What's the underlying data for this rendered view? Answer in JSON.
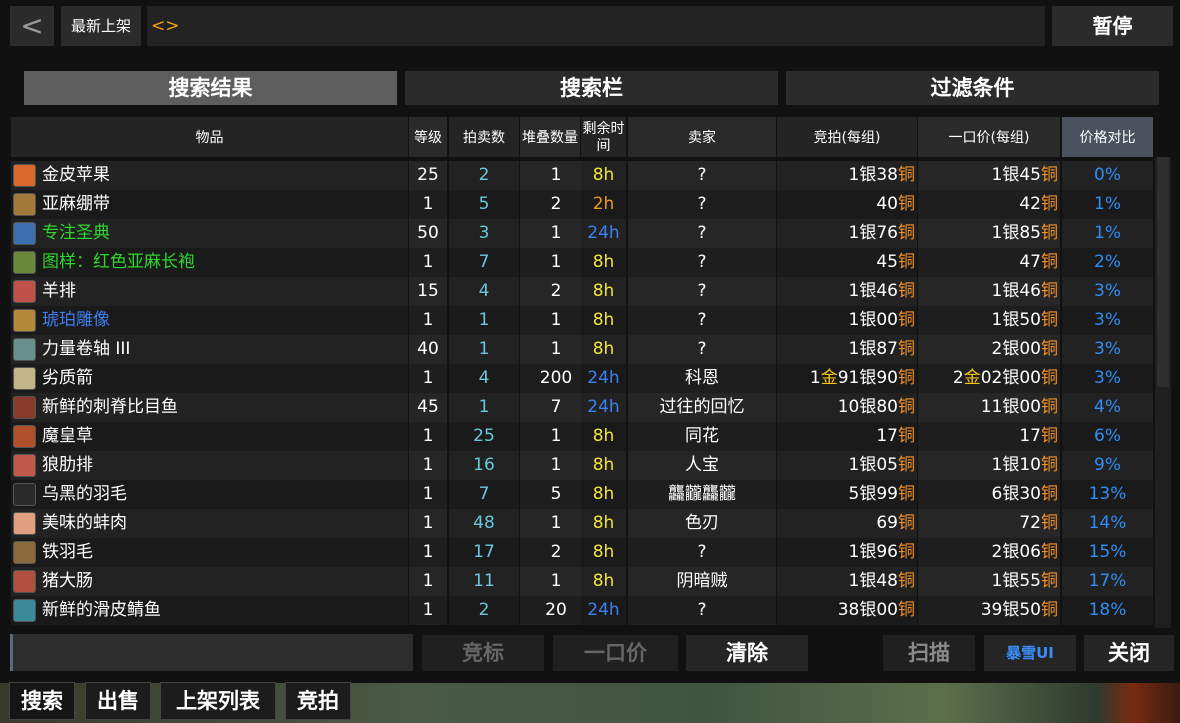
{
  "topbar": {
    "back_label": "<",
    "tag_label": "最新上架",
    "search_value": "<>",
    "pause_label": "暂停"
  },
  "tabs": [
    "搜索结果",
    "搜索栏",
    "过滤条件"
  ],
  "columns": {
    "item": "物品",
    "level": "等级",
    "auctions": "拍卖数",
    "stack": "堆叠数量",
    "time": "剩余时间",
    "seller": "卖家",
    "bid": "竞拍(每组)",
    "buyout": "一口价(每组)",
    "compare": "价格对比"
  },
  "rows": [
    {
      "name": "金皮苹果",
      "quality": "white",
      "icon": "apple-icon",
      "level": "25",
      "auctions": "2",
      "stack": "1",
      "time": "8h",
      "seller": "?",
      "bid": [
        [
          "1",
          "银"
        ],
        [
          "38",
          "铜"
        ]
      ],
      "buyout": [
        [
          "1",
          "银"
        ],
        [
          "45",
          "铜"
        ]
      ],
      "pct": "0%"
    },
    {
      "name": "亚麻绷带",
      "quality": "white",
      "icon": "bandage-icon",
      "level": "1",
      "auctions": "5",
      "stack": "2",
      "time": "2h",
      "seller": "?",
      "bid": [
        [
          "40",
          "铜"
        ]
      ],
      "buyout": [
        [
          "42",
          "铜"
        ]
      ],
      "pct": "1%"
    },
    {
      "name": "专注圣典",
      "quality": "green",
      "icon": "book-icon",
      "level": "50",
      "auctions": "3",
      "stack": "1",
      "time": "24h",
      "seller": "?",
      "bid": [
        [
          "1",
          "银"
        ],
        [
          "76",
          "铜"
        ]
      ],
      "buyout": [
        [
          "1",
          "银"
        ],
        [
          "85",
          "铜"
        ]
      ],
      "pct": "1%"
    },
    {
      "name": "图样：红色亚麻长袍",
      "quality": "green",
      "icon": "pattern-icon",
      "level": "1",
      "auctions": "7",
      "stack": "1",
      "time": "8h",
      "seller": "?",
      "bid": [
        [
          "45",
          "铜"
        ]
      ],
      "buyout": [
        [
          "47",
          "铜"
        ]
      ],
      "pct": "2%"
    },
    {
      "name": "羊排",
      "quality": "white",
      "icon": "meat-icon",
      "level": "15",
      "auctions": "4",
      "stack": "2",
      "time": "8h",
      "seller": "?",
      "bid": [
        [
          "1",
          "银"
        ],
        [
          "46",
          "铜"
        ]
      ],
      "buyout": [
        [
          "1",
          "银"
        ],
        [
          "46",
          "铜"
        ]
      ],
      "pct": "3%"
    },
    {
      "name": "琥珀雕像",
      "quality": "blue",
      "icon": "statue-icon",
      "level": "1",
      "auctions": "1",
      "stack": "1",
      "time": "8h",
      "seller": "?",
      "bid": [
        [
          "1",
          "银"
        ],
        [
          "00",
          "铜"
        ]
      ],
      "buyout": [
        [
          "1",
          "银"
        ],
        [
          "50",
          "铜"
        ]
      ],
      "pct": "3%"
    },
    {
      "name": "力量卷轴 III",
      "quality": "white",
      "icon": "scroll-icon",
      "level": "40",
      "auctions": "1",
      "stack": "1",
      "time": "8h",
      "seller": "?",
      "bid": [
        [
          "1",
          "银"
        ],
        [
          "87",
          "铜"
        ]
      ],
      "buyout": [
        [
          "2",
          "银"
        ],
        [
          "00",
          "铜"
        ]
      ],
      "pct": "3%"
    },
    {
      "name": "劣质箭",
      "quality": "white",
      "icon": "arrow-icon",
      "level": "1",
      "auctions": "4",
      "stack": "200",
      "time": "24h",
      "seller": "科恩",
      "bid": [
        [
          "1",
          "金"
        ],
        [
          "91",
          "银"
        ],
        [
          "90",
          "铜"
        ]
      ],
      "buyout": [
        [
          "2",
          "金"
        ],
        [
          "02",
          "银"
        ],
        [
          "00",
          "铜"
        ]
      ],
      "pct": "3%"
    },
    {
      "name": "新鲜的刺脊比目鱼",
      "quality": "white",
      "icon": "fish-icon",
      "level": "45",
      "auctions": "1",
      "stack": "7",
      "time": "24h",
      "seller": "过往的回忆",
      "bid": [
        [
          "10",
          "银"
        ],
        [
          "80",
          "铜"
        ]
      ],
      "buyout": [
        [
          "11",
          "银"
        ],
        [
          "00",
          "铜"
        ]
      ],
      "pct": "4%"
    },
    {
      "name": "魔皇草",
      "quality": "white",
      "icon": "herb-icon",
      "level": "1",
      "auctions": "25",
      "stack": "1",
      "time": "8h",
      "seller": "同花",
      "bid": [
        [
          "17",
          "铜"
        ]
      ],
      "buyout": [
        [
          "17",
          "铜"
        ]
      ],
      "pct": "6%"
    },
    {
      "name": "狼肋排",
      "quality": "white",
      "icon": "ribs-icon",
      "level": "1",
      "auctions": "16",
      "stack": "1",
      "time": "8h",
      "seller": "人宝",
      "bid": [
        [
          "1",
          "银"
        ],
        [
          "05",
          "铜"
        ]
      ],
      "buyout": [
        [
          "1",
          "银"
        ],
        [
          "10",
          "铜"
        ]
      ],
      "pct": "9%"
    },
    {
      "name": "乌黑的羽毛",
      "quality": "white",
      "icon": "feather-icon",
      "level": "1",
      "auctions": "7",
      "stack": "5",
      "time": "8h",
      "seller": "龘龖龘龖",
      "bid": [
        [
          "5",
          "银"
        ],
        [
          "99",
          "铜"
        ]
      ],
      "buyout": [
        [
          "6",
          "银"
        ],
        [
          "30",
          "铜"
        ]
      ],
      "pct": "13%"
    },
    {
      "name": "美味的蚌肉",
      "quality": "white",
      "icon": "clam-icon",
      "level": "1",
      "auctions": "48",
      "stack": "1",
      "time": "8h",
      "seller": "色刃",
      "bid": [
        [
          "69",
          "铜"
        ]
      ],
      "buyout": [
        [
          "72",
          "铜"
        ]
      ],
      "pct": "14%"
    },
    {
      "name": "铁羽毛",
      "quality": "white",
      "icon": "iron-feather-icon",
      "level": "1",
      "auctions": "17",
      "stack": "2",
      "time": "8h",
      "seller": "?",
      "bid": [
        [
          "1",
          "银"
        ],
        [
          "96",
          "铜"
        ]
      ],
      "buyout": [
        [
          "2",
          "银"
        ],
        [
          "06",
          "铜"
        ]
      ],
      "pct": "15%"
    },
    {
      "name": "猪大肠",
      "quality": "white",
      "icon": "intestine-icon",
      "level": "1",
      "auctions": "11",
      "stack": "1",
      "time": "8h",
      "seller": "阴暗贼",
      "bid": [
        [
          "1",
          "银"
        ],
        [
          "48",
          "铜"
        ]
      ],
      "buyout": [
        [
          "1",
          "银"
        ],
        [
          "55",
          "铜"
        ]
      ],
      "pct": "17%"
    },
    {
      "name": "新鲜的滑皮鲭鱼",
      "quality": "white",
      "icon": "mackerel-icon",
      "level": "1",
      "auctions": "2",
      "stack": "20",
      "time": "24h",
      "seller": "?",
      "bid": [
        [
          "38",
          "银"
        ],
        [
          "00",
          "铜"
        ]
      ],
      "buyout": [
        [
          "39",
          "银"
        ],
        [
          "50",
          "铜"
        ]
      ],
      "pct": "18%"
    }
  ],
  "controls": {
    "bid_label": "竞标",
    "buyout_label": "一口价",
    "clear_label": "清除",
    "scan_label": "扫描",
    "blizzui_label": "暴雪UI",
    "close_label": "关闭"
  },
  "bottom_tabs": [
    "搜索",
    "出售",
    "上架列表",
    "竞拍"
  ],
  "colors": {
    "quality_white": "#ffffff",
    "quality_green": "#2ed62e",
    "quality_blue": "#3f7cec",
    "gold_currency": "#f5c31a",
    "copper_currency": "#f2912c",
    "time_8h": "#f3e43a",
    "time_2h": "#f09a1f",
    "time_24h": "#3a82f0",
    "pct": "#2f8ef5",
    "auction_count": "#68c8dd"
  }
}
